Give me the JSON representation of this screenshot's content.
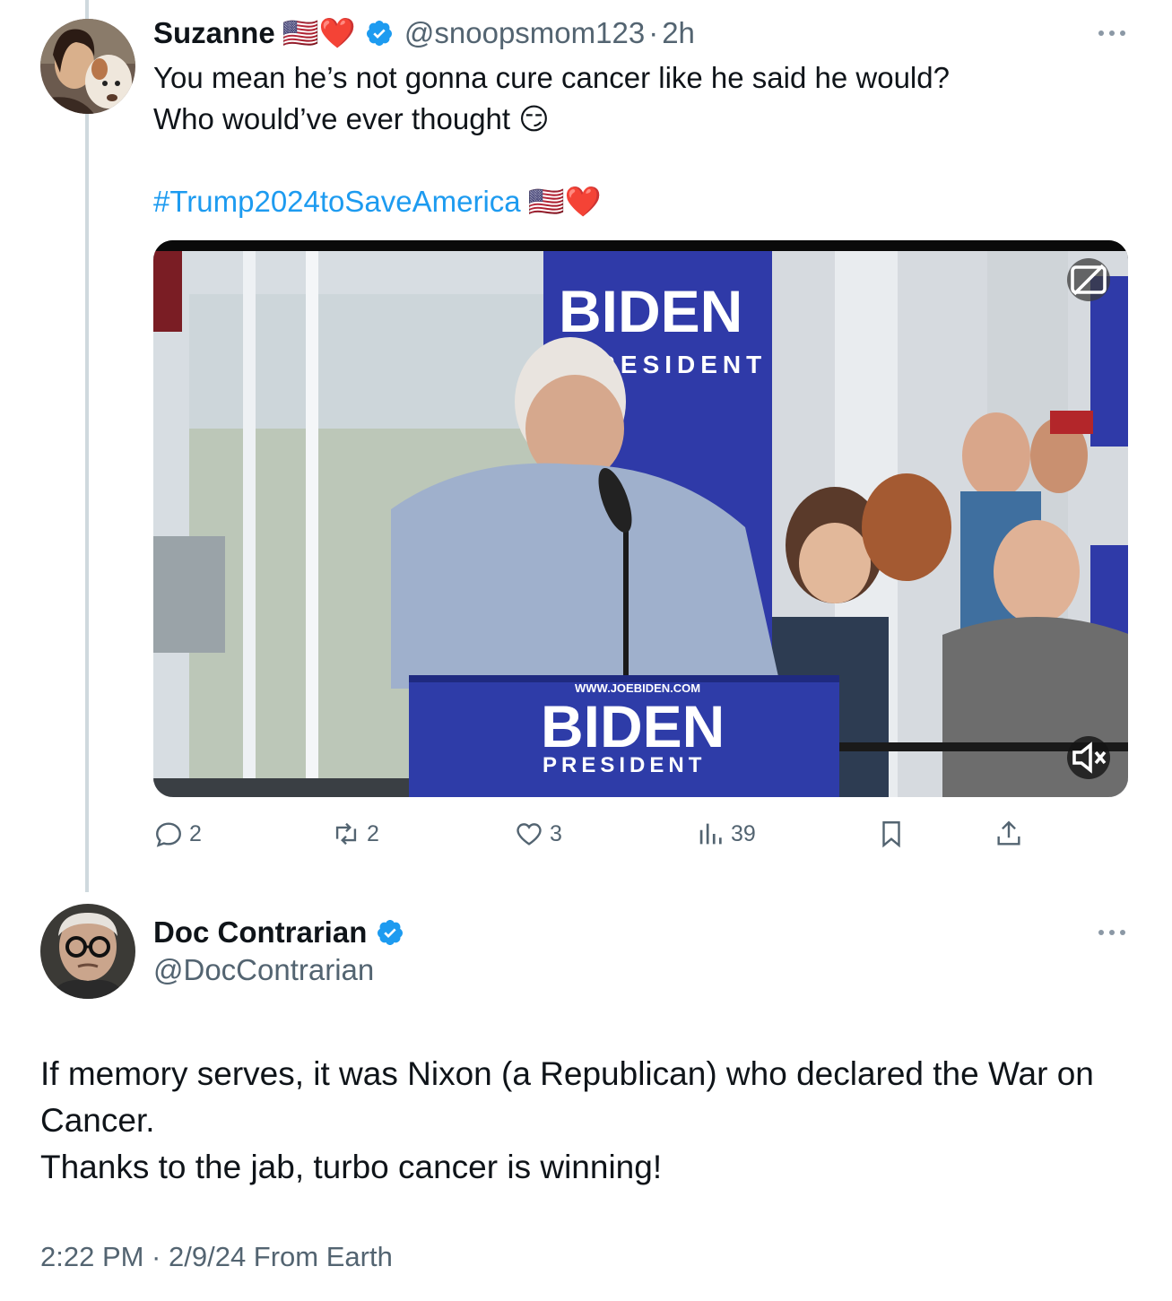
{
  "original_tweet": {
    "author_name": "Suzanne",
    "name_emojis": "🇺🇸❤️",
    "handle": "@snoopsmom123",
    "separator": "·",
    "time": "2h",
    "text_lines": [
      "You mean he’s not gonna cure cancer like he said he would?",
      "Who would’ve ever thought 😏"
    ],
    "hashtag": "#Trump2024toSaveAmerica",
    "hashtag_emojis": "🇺🇸❤️",
    "media": {
      "podium_text_small": "WWW.JOEBIDEN.COM",
      "podium_text_big": "BIDEN",
      "podium_text_sub": "PRESIDENT",
      "banner_text_big": "BIDEN",
      "banner_text_sub": "PRESIDENT"
    },
    "stats": {
      "replies": "2",
      "reposts": "2",
      "likes": "3",
      "views": "39"
    }
  },
  "reply_tweet": {
    "author_name": "Doc Contrarian",
    "handle": "@DocContrarian",
    "text_lines": [
      "If memory serves, it was Nixon (a Republican) who declared the War on",
      "Cancer.",
      "Thanks to the jab, turbo cancer is winning!"
    ],
    "timestamp": "2:22 PM · 2/9/24 From Earth"
  },
  "colors": {
    "link": "#1d9bf0",
    "secondary_text": "#536471",
    "verified": "#1d9bf0",
    "thread_line": "#cfd9de"
  },
  "icons": [
    "more-icon",
    "verified-badge-icon",
    "reply-icon",
    "repost-icon",
    "like-icon",
    "views-icon",
    "bookmark-icon",
    "share-icon",
    "captions-icon",
    "mute-icon"
  ]
}
